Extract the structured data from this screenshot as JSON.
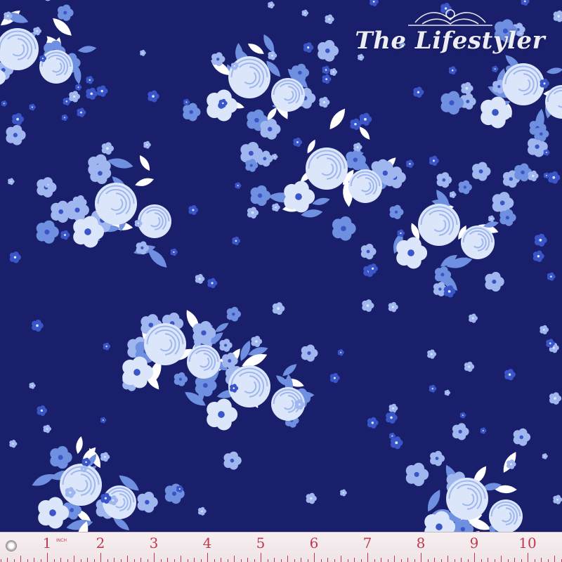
{
  "watermark": {
    "text": "The Lifestyler",
    "icon": "ornamental-crest-icon"
  },
  "ruler": {
    "unit_label": "INCH",
    "numbers": [
      "1",
      "2",
      "3",
      "4",
      "5",
      "6",
      "7",
      "8",
      "9",
      "10"
    ],
    "color": "#c0394c"
  },
  "fabric": {
    "background_color": "#1a1f6b",
    "flower_colors": [
      "#dbe6fb",
      "#9fb6ee",
      "#6f8fe0",
      "#3a55c8",
      "#ffffff"
    ]
  }
}
